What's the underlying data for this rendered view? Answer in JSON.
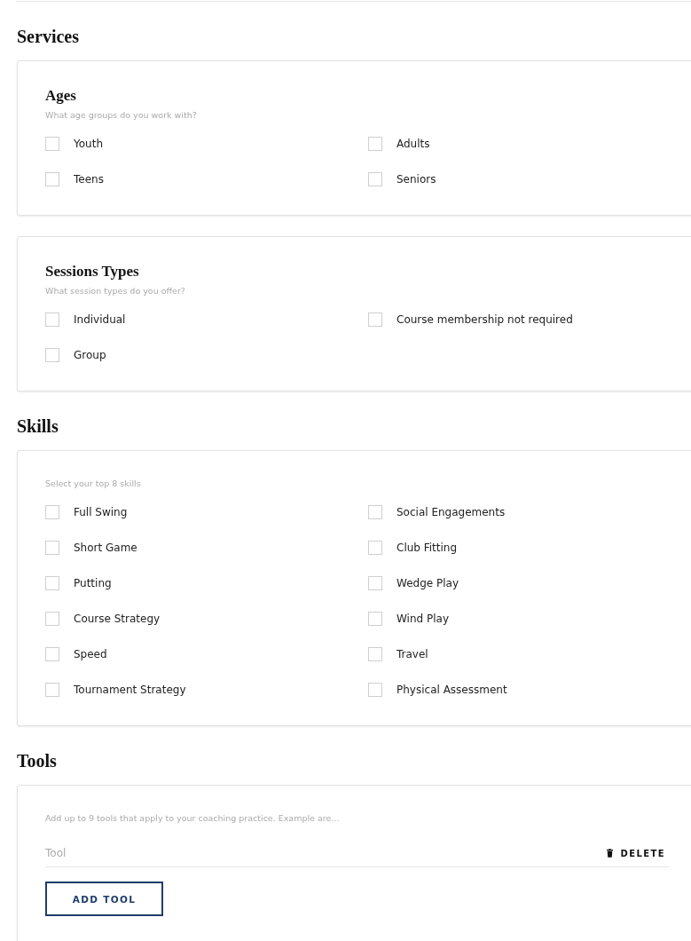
{
  "sections": [
    {
      "kind": "checklist",
      "heading": "Services",
      "cards": [
        {
          "title": "Ages",
          "subtitle": "What age groups do you work with?",
          "options": [
            {
              "label": "Youth",
              "checked": false
            },
            {
              "label": "Adults",
              "checked": false
            },
            {
              "label": "Teens",
              "checked": false
            },
            {
              "label": "Seniors",
              "checked": false
            }
          ]
        },
        {
          "title": "Sessions Types",
          "subtitle": "What session types do you offer?",
          "options": [
            {
              "label": "Individual",
              "checked": false
            },
            {
              "label": "Course membership not required",
              "checked": false
            },
            {
              "label": "Group",
              "checked": false
            }
          ]
        }
      ]
    },
    {
      "kind": "checklist",
      "heading": "Skills",
      "cards": [
        {
          "subtitle": "Select your top 8 skills",
          "options": [
            {
              "label": "Full Swing",
              "checked": false
            },
            {
              "label": "Social Engagements",
              "checked": false
            },
            {
              "label": "Short Game",
              "checked": false
            },
            {
              "label": "Club Fitting",
              "checked": false
            },
            {
              "label": "Putting",
              "checked": false
            },
            {
              "label": "Wedge Play",
              "checked": false
            },
            {
              "label": "Course Strategy",
              "checked": false
            },
            {
              "label": "Wind Play",
              "checked": false
            },
            {
              "label": "Speed",
              "checked": false
            },
            {
              "label": "Travel",
              "checked": false
            },
            {
              "label": "Tournament Strategy",
              "checked": false
            },
            {
              "label": "Physical Assessment",
              "checked": false
            }
          ]
        }
      ]
    },
    {
      "kind": "tools",
      "heading": "Tools",
      "subtitle": "Add up to 9 tools that apply to your coaching practice. Example are...",
      "tools": [
        {
          "placeholder": "Tool",
          "delete": "DELETE"
        }
      ],
      "add_button": "ADD TOOL"
    }
  ]
}
